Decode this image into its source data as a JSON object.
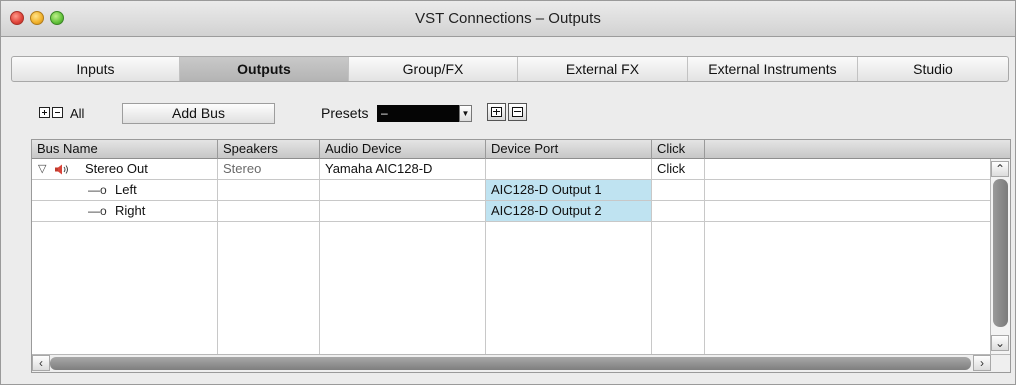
{
  "window": {
    "title": "VST Connections – Outputs"
  },
  "tabs": [
    {
      "label": "Inputs",
      "active": false
    },
    {
      "label": "Outputs",
      "active": true
    },
    {
      "label": "Group/FX",
      "active": false
    },
    {
      "label": "External FX",
      "active": false
    },
    {
      "label": "External Instruments",
      "active": false
    },
    {
      "label": "Studio",
      "active": false
    }
  ],
  "toolbar": {
    "all_label": "All",
    "add_bus_label": "Add Bus",
    "presets_label": "Presets",
    "presets_value": "–"
  },
  "table": {
    "columns": [
      "Bus Name",
      "Speakers",
      "Audio Device",
      "Device Port",
      "Click"
    ],
    "rows": [
      {
        "bus_name": "Stereo Out",
        "speakers": "Stereo",
        "audio_device": "Yamaha AIC128-D",
        "device_port": "",
        "click": "Click"
      },
      {
        "bus_name": "Left",
        "speakers": "",
        "audio_device": "",
        "device_port": "AIC128-D Output 1",
        "click": ""
      },
      {
        "bus_name": "Right",
        "speakers": "",
        "audio_device": "",
        "device_port": "AIC128-D Output 2",
        "click": ""
      }
    ]
  },
  "icons": {
    "disclosure": "disclosure-triangle-icon",
    "speaker": "speaker-icon",
    "channel": "channel-connector-icon"
  },
  "colors": {
    "selected_port_bg": "#bfe3f1",
    "presets_field_bg": "#050505"
  }
}
